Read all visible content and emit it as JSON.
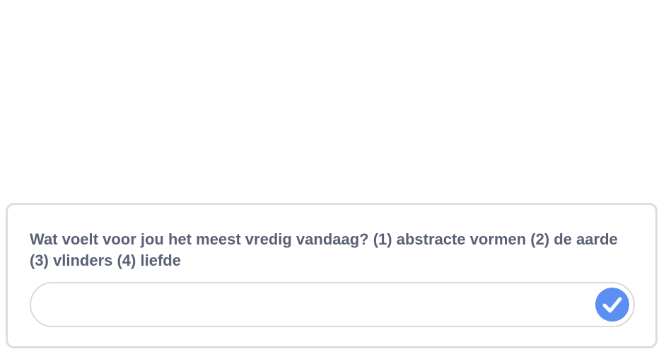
{
  "question": {
    "text": "Wat voelt voor jou het meest vredig vandaag? (1) abstracte vormen (2) de aarde (3) vlinders (4) liefde"
  },
  "answer": {
    "value": "",
    "placeholder": ""
  },
  "submit": {
    "icon": "check-icon",
    "color": "#5b8ff2"
  }
}
